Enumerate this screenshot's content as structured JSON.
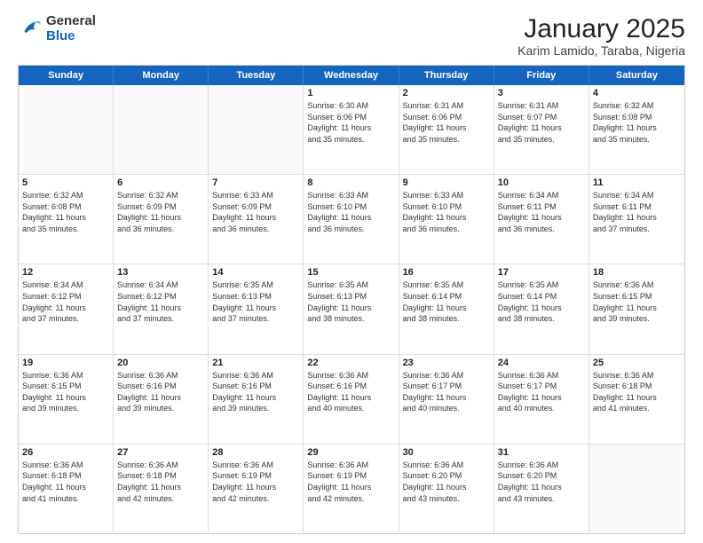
{
  "header": {
    "logo_general": "General",
    "logo_blue": "Blue",
    "month_title": "January 2025",
    "subtitle": "Karim Lamido, Taraba, Nigeria"
  },
  "weekdays": [
    "Sunday",
    "Monday",
    "Tuesday",
    "Wednesday",
    "Thursday",
    "Friday",
    "Saturday"
  ],
  "weeks": [
    [
      {
        "day": "",
        "info": ""
      },
      {
        "day": "",
        "info": ""
      },
      {
        "day": "",
        "info": ""
      },
      {
        "day": "1",
        "info": "Sunrise: 6:30 AM\nSunset: 6:06 PM\nDaylight: 11 hours\nand 35 minutes."
      },
      {
        "day": "2",
        "info": "Sunrise: 6:31 AM\nSunset: 6:06 PM\nDaylight: 11 hours\nand 35 minutes."
      },
      {
        "day": "3",
        "info": "Sunrise: 6:31 AM\nSunset: 6:07 PM\nDaylight: 11 hours\nand 35 minutes."
      },
      {
        "day": "4",
        "info": "Sunrise: 6:32 AM\nSunset: 6:08 PM\nDaylight: 11 hours\nand 35 minutes."
      }
    ],
    [
      {
        "day": "5",
        "info": "Sunrise: 6:32 AM\nSunset: 6:08 PM\nDaylight: 11 hours\nand 35 minutes."
      },
      {
        "day": "6",
        "info": "Sunrise: 6:32 AM\nSunset: 6:09 PM\nDaylight: 11 hours\nand 36 minutes."
      },
      {
        "day": "7",
        "info": "Sunrise: 6:33 AM\nSunset: 6:09 PM\nDaylight: 11 hours\nand 36 minutes."
      },
      {
        "day": "8",
        "info": "Sunrise: 6:33 AM\nSunset: 6:10 PM\nDaylight: 11 hours\nand 36 minutes."
      },
      {
        "day": "9",
        "info": "Sunrise: 6:33 AM\nSunset: 6:10 PM\nDaylight: 11 hours\nand 36 minutes."
      },
      {
        "day": "10",
        "info": "Sunrise: 6:34 AM\nSunset: 6:11 PM\nDaylight: 11 hours\nand 36 minutes."
      },
      {
        "day": "11",
        "info": "Sunrise: 6:34 AM\nSunset: 6:11 PM\nDaylight: 11 hours\nand 37 minutes."
      }
    ],
    [
      {
        "day": "12",
        "info": "Sunrise: 6:34 AM\nSunset: 6:12 PM\nDaylight: 11 hours\nand 37 minutes."
      },
      {
        "day": "13",
        "info": "Sunrise: 6:34 AM\nSunset: 6:12 PM\nDaylight: 11 hours\nand 37 minutes."
      },
      {
        "day": "14",
        "info": "Sunrise: 6:35 AM\nSunset: 6:13 PM\nDaylight: 11 hours\nand 37 minutes."
      },
      {
        "day": "15",
        "info": "Sunrise: 6:35 AM\nSunset: 6:13 PM\nDaylight: 11 hours\nand 38 minutes."
      },
      {
        "day": "16",
        "info": "Sunrise: 6:35 AM\nSunset: 6:14 PM\nDaylight: 11 hours\nand 38 minutes."
      },
      {
        "day": "17",
        "info": "Sunrise: 6:35 AM\nSunset: 6:14 PM\nDaylight: 11 hours\nand 38 minutes."
      },
      {
        "day": "18",
        "info": "Sunrise: 6:36 AM\nSunset: 6:15 PM\nDaylight: 11 hours\nand 39 minutes."
      }
    ],
    [
      {
        "day": "19",
        "info": "Sunrise: 6:36 AM\nSunset: 6:15 PM\nDaylight: 11 hours\nand 39 minutes."
      },
      {
        "day": "20",
        "info": "Sunrise: 6:36 AM\nSunset: 6:16 PM\nDaylight: 11 hours\nand 39 minutes."
      },
      {
        "day": "21",
        "info": "Sunrise: 6:36 AM\nSunset: 6:16 PM\nDaylight: 11 hours\nand 39 minutes."
      },
      {
        "day": "22",
        "info": "Sunrise: 6:36 AM\nSunset: 6:16 PM\nDaylight: 11 hours\nand 40 minutes."
      },
      {
        "day": "23",
        "info": "Sunrise: 6:36 AM\nSunset: 6:17 PM\nDaylight: 11 hours\nand 40 minutes."
      },
      {
        "day": "24",
        "info": "Sunrise: 6:36 AM\nSunset: 6:17 PM\nDaylight: 11 hours\nand 40 minutes."
      },
      {
        "day": "25",
        "info": "Sunrise: 6:36 AM\nSunset: 6:18 PM\nDaylight: 11 hours\nand 41 minutes."
      }
    ],
    [
      {
        "day": "26",
        "info": "Sunrise: 6:36 AM\nSunset: 6:18 PM\nDaylight: 11 hours\nand 41 minutes."
      },
      {
        "day": "27",
        "info": "Sunrise: 6:36 AM\nSunset: 6:18 PM\nDaylight: 11 hours\nand 42 minutes."
      },
      {
        "day": "28",
        "info": "Sunrise: 6:36 AM\nSunset: 6:19 PM\nDaylight: 11 hours\nand 42 minutes."
      },
      {
        "day": "29",
        "info": "Sunrise: 6:36 AM\nSunset: 6:19 PM\nDaylight: 11 hours\nand 42 minutes."
      },
      {
        "day": "30",
        "info": "Sunrise: 6:36 AM\nSunset: 6:20 PM\nDaylight: 11 hours\nand 43 minutes."
      },
      {
        "day": "31",
        "info": "Sunrise: 6:36 AM\nSunset: 6:20 PM\nDaylight: 11 hours\nand 43 minutes."
      },
      {
        "day": "",
        "info": ""
      }
    ]
  ]
}
